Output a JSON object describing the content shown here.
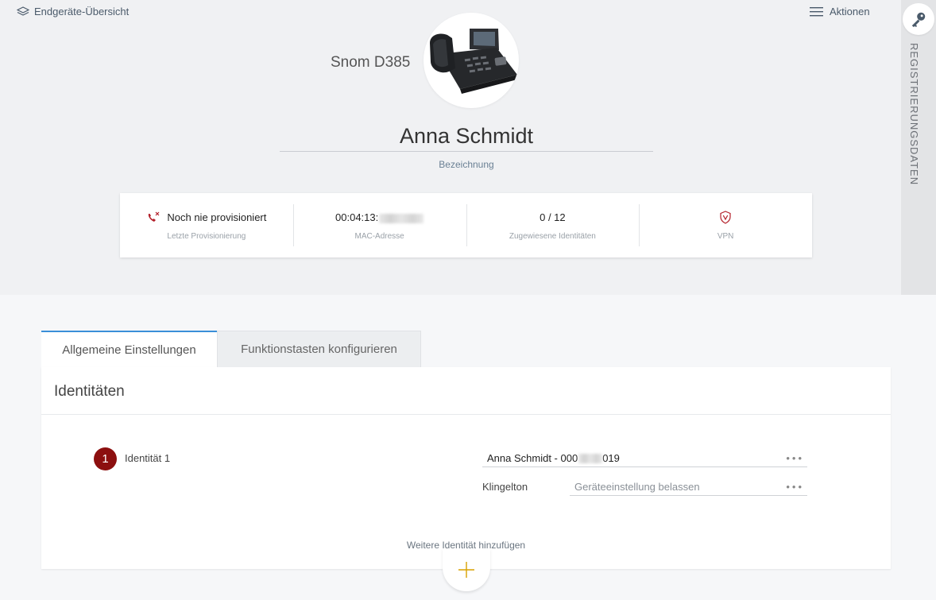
{
  "header": {
    "back_label": "Endgeräte-Übersicht",
    "actions_label": "Aktionen",
    "side_tab_label": "REGISTRIERUNGSDATEN"
  },
  "device": {
    "model": "Snom D385",
    "name": "Anna Schmidt",
    "name_label": "Bezeichnung"
  },
  "status": {
    "provisioning_value": "Noch nie provisioniert",
    "provisioning_label": "Letzte Provisionierung",
    "mac_prefix": "00:04:13:",
    "mac_label": "MAC-Adresse",
    "identities_value": "0 / 12",
    "identities_label": "Zugewiesene Identitäten",
    "vpn_label": "VPN"
  },
  "tabs": [
    {
      "label": "Allgemeine Einstellungen",
      "active": true
    },
    {
      "label": "Funktionstasten konfigurieren",
      "active": false
    }
  ],
  "identities": {
    "title": "Identitäten",
    "items": [
      {
        "number": "1",
        "label": "Identität 1",
        "value_prefix": "Anna Schmidt - 000",
        "value_suffix": "019",
        "ringtone_label": "Klingelton",
        "ringtone_value": "Geräteeinstellung belassen"
      }
    ],
    "add_label": "Weitere Identität hinzufügen"
  },
  "colors": {
    "accent": "#3a8fd8",
    "badge": "#8c0f0f",
    "alert_red": "#b3202a",
    "add_plus": "#d8a100"
  },
  "icons": {
    "back": "layers-icon",
    "actions": "menu-icon",
    "side": "key-icon",
    "provisioning": "phone-error-icon",
    "vpn": "shield-v-icon",
    "add": "plus-icon"
  }
}
